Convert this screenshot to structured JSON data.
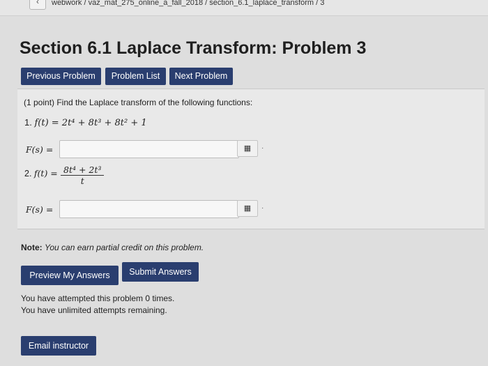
{
  "breadcrumb": "webwork / vaz_mat_275_online_a_fall_2018 / section_6.1_laplace_transform / 3",
  "back_glyph": "‹",
  "page_title": "Section 6.1 Laplace Transform: Problem 3",
  "nav": {
    "previous": "Previous Problem",
    "list": "Problem List",
    "next": "Next Problem"
  },
  "problem": {
    "intro": "(1 point) Find the Laplace transform of the following functions:",
    "item1_prefix": "1.",
    "item1_formula": "f(t) = 2t⁴ + 8t³ + 8t² + 1",
    "answer_label": "F(s) =",
    "item2_prefix": "2.",
    "item2_lhs": "f(t) =",
    "item2_numerator": "8t⁴ + 2t³",
    "item2_denominator": "t",
    "answer1_value": "",
    "answer2_value": "",
    "matrix_glyph": "▦",
    "dot": "·"
  },
  "note": {
    "label": "Note:",
    "text": "You can earn partial credit on this problem."
  },
  "actions": {
    "preview": "Preview My Answers",
    "submit": "Submit Answers",
    "email": "Email instructor"
  },
  "status": {
    "attempted": "You have attempted this problem 0 times.",
    "remaining": "You have unlimited attempts remaining."
  },
  "colors": {
    "button_bg": "#2a3e6f",
    "page_bg": "#dedede"
  }
}
